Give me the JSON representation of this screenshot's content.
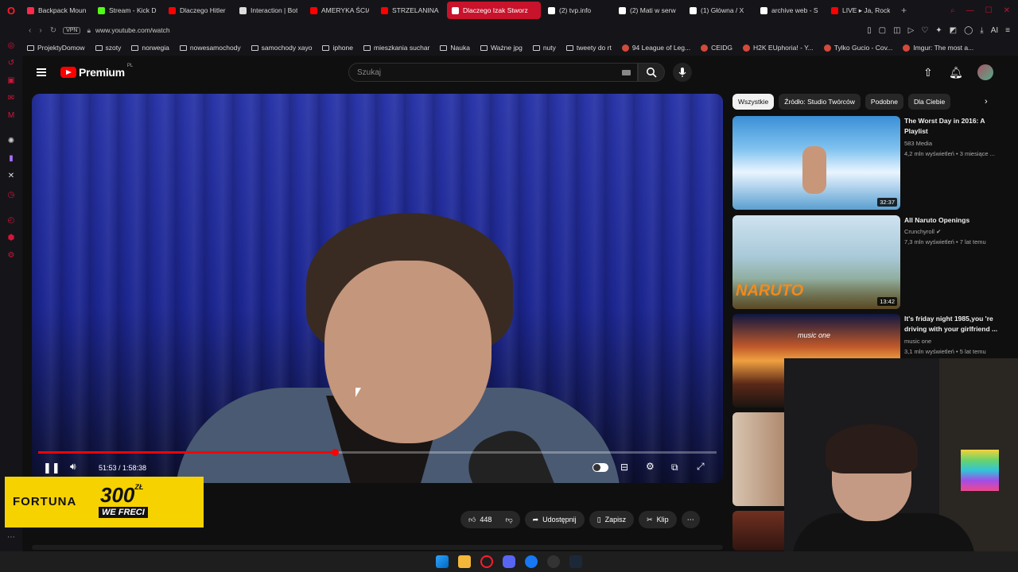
{
  "browser": {
    "tabs": [
      {
        "title": "Backpack Moun",
        "favicon_color": "#ff2a4a"
      },
      {
        "title": "Stream - Kick D",
        "favicon_color": "#53fc18"
      },
      {
        "title": "Dlaczego Hitler",
        "favicon_color": "#ff0000"
      },
      {
        "title": "Interaction | Bot",
        "favicon_color": "#dddddd"
      },
      {
        "title": "AMERYKA ŚCIĄG",
        "favicon_color": "#ff0000"
      },
      {
        "title": "STRZELANINA W",
        "favicon_color": "#ff0000"
      },
      {
        "title": "Dlaczego Izak Stworz",
        "favicon_color": "#ffffff",
        "active": true
      },
      {
        "title": "(2) tvp.info",
        "favicon_color": "#ffffff"
      },
      {
        "title": "(2) Mati w serw",
        "favicon_color": "#ffffff"
      },
      {
        "title": "(1) Główna / X",
        "favicon_color": "#ffffff"
      },
      {
        "title": "archive web - S",
        "favicon_color": "#ffffff"
      },
      {
        "title": "LIVE ▸ Ja, Rock",
        "favicon_color": "#ff0000"
      }
    ],
    "new_tab": "+",
    "url": "www.youtube.com/watch",
    "vpn_label": "VPN",
    "bookmarks": [
      {
        "label": "ProjektyDomow",
        "icon": "folder"
      },
      {
        "label": "szoty",
        "icon": "folder"
      },
      {
        "label": "norwegia",
        "icon": "folder"
      },
      {
        "label": "nowesamochody",
        "icon": "folder"
      },
      {
        "label": "samochody xayo",
        "icon": "folder"
      },
      {
        "label": "iphone",
        "icon": "folder"
      },
      {
        "label": "mieszkania suchar",
        "icon": "folder"
      },
      {
        "label": "Nauka",
        "icon": "folder"
      },
      {
        "label": "Ważne jpg",
        "icon": "folder"
      },
      {
        "label": "nuty",
        "icon": "folder"
      },
      {
        "label": "tweety do rt",
        "icon": "folder"
      },
      {
        "label": "94 League of Leg...",
        "icon": "site"
      },
      {
        "label": "CEIDG",
        "icon": "site"
      },
      {
        "label": "H2K EUphoria! - Y...",
        "icon": "site"
      },
      {
        "label": "Tylko Gucio - Cov...",
        "icon": "site"
      },
      {
        "label": "Imgur: The most a...",
        "icon": "site"
      }
    ]
  },
  "youtube": {
    "logo_text": "Premium",
    "logo_region": "PL",
    "search_placeholder": "Szukaj",
    "player": {
      "current_time": "51:53",
      "duration": "1:58:38",
      "time_display": "51:53 / 1:58:38",
      "progress": 0.437
    },
    "actions": {
      "likes": "448",
      "share": "Udostępnij",
      "save": "Zapisz",
      "clip": "Klip"
    },
    "chips": [
      "Wszystkie",
      "Źródło: Studio Twórców",
      "Podobne",
      "Dla Ciebie"
    ],
    "recommendations": [
      {
        "title": "The Worst Day in 2016: A Playlist",
        "channel": "583 Media",
        "meta": "4,2 mln wyświetleń • 3 miesiące ...",
        "duration": "32:37"
      },
      {
        "title": "All Naruto Openings",
        "channel": "Crunchyroll",
        "meta": "7,3 mln wyświetleń • 7 lat temu",
        "duration": "13:42",
        "thumb_text": "NARUTO"
      },
      {
        "title": "It's friday night 1985,you 're driving with your girlfriend ...",
        "channel": "music one",
        "meta": "3,1 mln wyświetleń • 5 lat temu",
        "thumb_text": "music one"
      }
    ]
  },
  "ad": {
    "brand": "FORTUNA",
    "amount": "300",
    "currency": "ZŁ",
    "tagline": "WE FRECI"
  }
}
